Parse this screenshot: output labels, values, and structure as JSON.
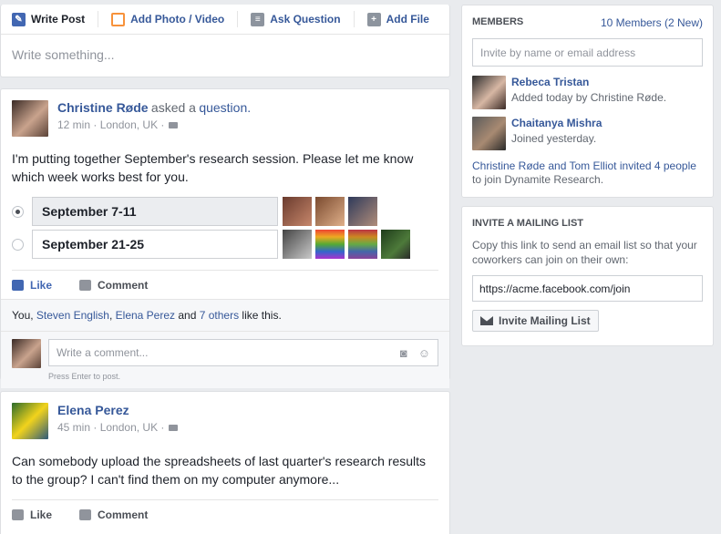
{
  "composer": {
    "tabs": [
      {
        "label": "Write Post",
        "icon": "pencil-icon"
      },
      {
        "label": "Add Photo / Video",
        "icon": "photo-icon"
      },
      {
        "label": "Ask Question",
        "icon": "question-list-icon"
      },
      {
        "label": "Add File",
        "icon": "plus-file-icon"
      }
    ],
    "placeholder": "Write something..."
  },
  "post1": {
    "author": "Christine Røde",
    "action_prefix": "asked a",
    "action_link": "question.",
    "time": "12 min",
    "location": "London, UK",
    "text": "I'm putting together September's research session. Please let me know which week works best for you.",
    "poll": [
      {
        "label": "September 7-11",
        "selected": true
      },
      {
        "label": "September 21-25",
        "selected": false
      }
    ],
    "like_label": "Like",
    "comment_label": "Comment",
    "likes": {
      "prefix": "You, ",
      "person1": "Steven English",
      "comma": ", ",
      "person2": "Elena Perez",
      "and": " and ",
      "others": "7 others",
      "suffix": " like this."
    },
    "comment_placeholder": "Write a comment...",
    "hint": "Press Enter to post."
  },
  "post2": {
    "author": "Elena Perez",
    "time": "45 min",
    "location": "London, UK",
    "text": "Can somebody upload the spreadsheets of last quarter's research results to the group? I can't find them on my computer anymore...",
    "like_label": "Like",
    "comment_label": "Comment"
  },
  "members": {
    "title": "MEMBERS",
    "count": "10 Members (2 New)",
    "invite_placeholder": "Invite by name or email address",
    "list": [
      {
        "name": "Rebeca Tristan",
        "desc": "Added today by Christine Røde."
      },
      {
        "name": "Chaitanya Mishra",
        "desc": "Joined yesterday."
      }
    ],
    "invited": {
      "who": "Christine Røde and Tom Elliot invited ",
      "count": "4 people",
      "suffix": " to join Dynamite Research."
    }
  },
  "mailing": {
    "title": "INVITE A MAILING LIST",
    "desc": "Copy this link to send an email list so that your coworkers can join on their own:",
    "link": "https://acme.facebook.com/join",
    "button": "Invite Mailing List"
  },
  "colors": {
    "brand": "#365899",
    "like_blue": "#4267b2",
    "bg": "#e9ebee"
  }
}
